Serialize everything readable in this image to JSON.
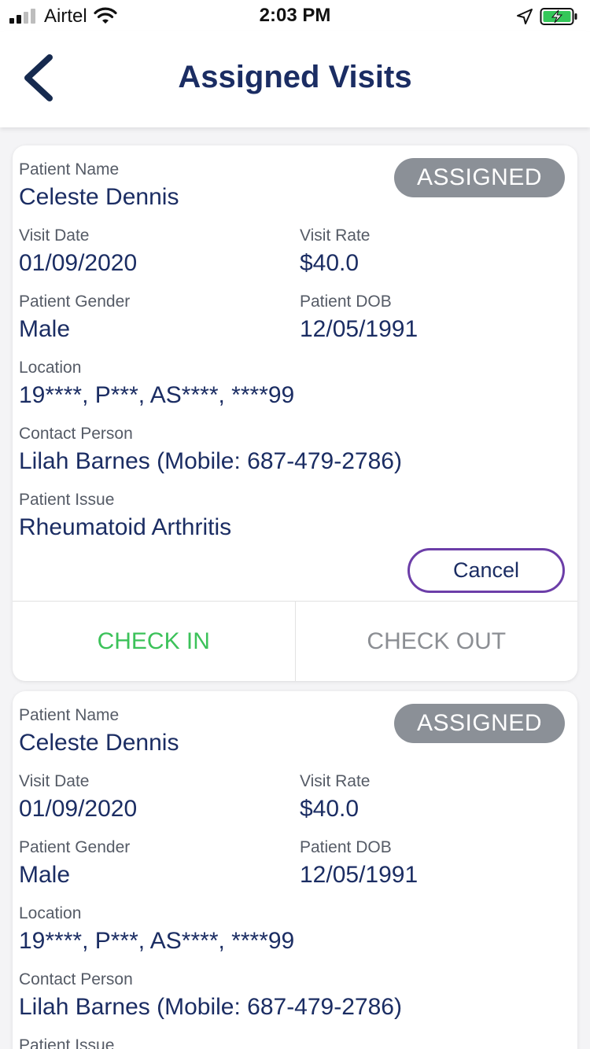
{
  "status_bar": {
    "carrier": "Airtel",
    "time": "2:03 PM",
    "signal_bars_active": 2,
    "signal_bars_total": 4,
    "battery_charging": true,
    "battery_color": "#34c759"
  },
  "header": {
    "title": "Assigned Visits",
    "back_icon": "chevron-left-icon"
  },
  "colors": {
    "primary_text": "#1b2d63",
    "label_text": "#555b66",
    "badge_bg": "#8b9097",
    "check_in": "#3cc25a",
    "check_out": "#8b8e93",
    "cancel_border": "#6c3ea8"
  },
  "visits": [
    {
      "status": "ASSIGNED",
      "patient_name_label": "Patient Name",
      "patient_name": "Celeste Dennis",
      "visit_date_label": "Visit Date",
      "visit_date": "01/09/2020",
      "visit_rate_label": "Visit Rate",
      "visit_rate": "$40.0",
      "gender_label": "Patient Gender",
      "gender": "Male",
      "dob_label": "Patient DOB",
      "dob": "12/05/1991",
      "location_label": "Location",
      "location": "19****, P***, AS****, ****99",
      "contact_label": "Contact Person",
      "contact": "Lilah Barnes (Mobile: 687-479-2786)",
      "issue_label": "Patient Issue",
      "issue": "Rheumatoid Arthritis",
      "cancel_label": "Cancel",
      "check_in_label": "CHECK IN",
      "check_out_label": "CHECK OUT"
    },
    {
      "status": "ASSIGNED",
      "patient_name_label": "Patient Name",
      "patient_name": "Celeste Dennis",
      "visit_date_label": "Visit Date",
      "visit_date": "01/09/2020",
      "visit_rate_label": "Visit Rate",
      "visit_rate": "$40.0",
      "gender_label": "Patient Gender",
      "gender": "Male",
      "dob_label": "Patient DOB",
      "dob": "12/05/1991",
      "location_label": "Location",
      "location": "19****, P***, AS****, ****99",
      "contact_label": "Contact Person",
      "contact": "Lilah Barnes (Mobile: 687-479-2786)",
      "issue_label": "Patient Issue"
    }
  ]
}
